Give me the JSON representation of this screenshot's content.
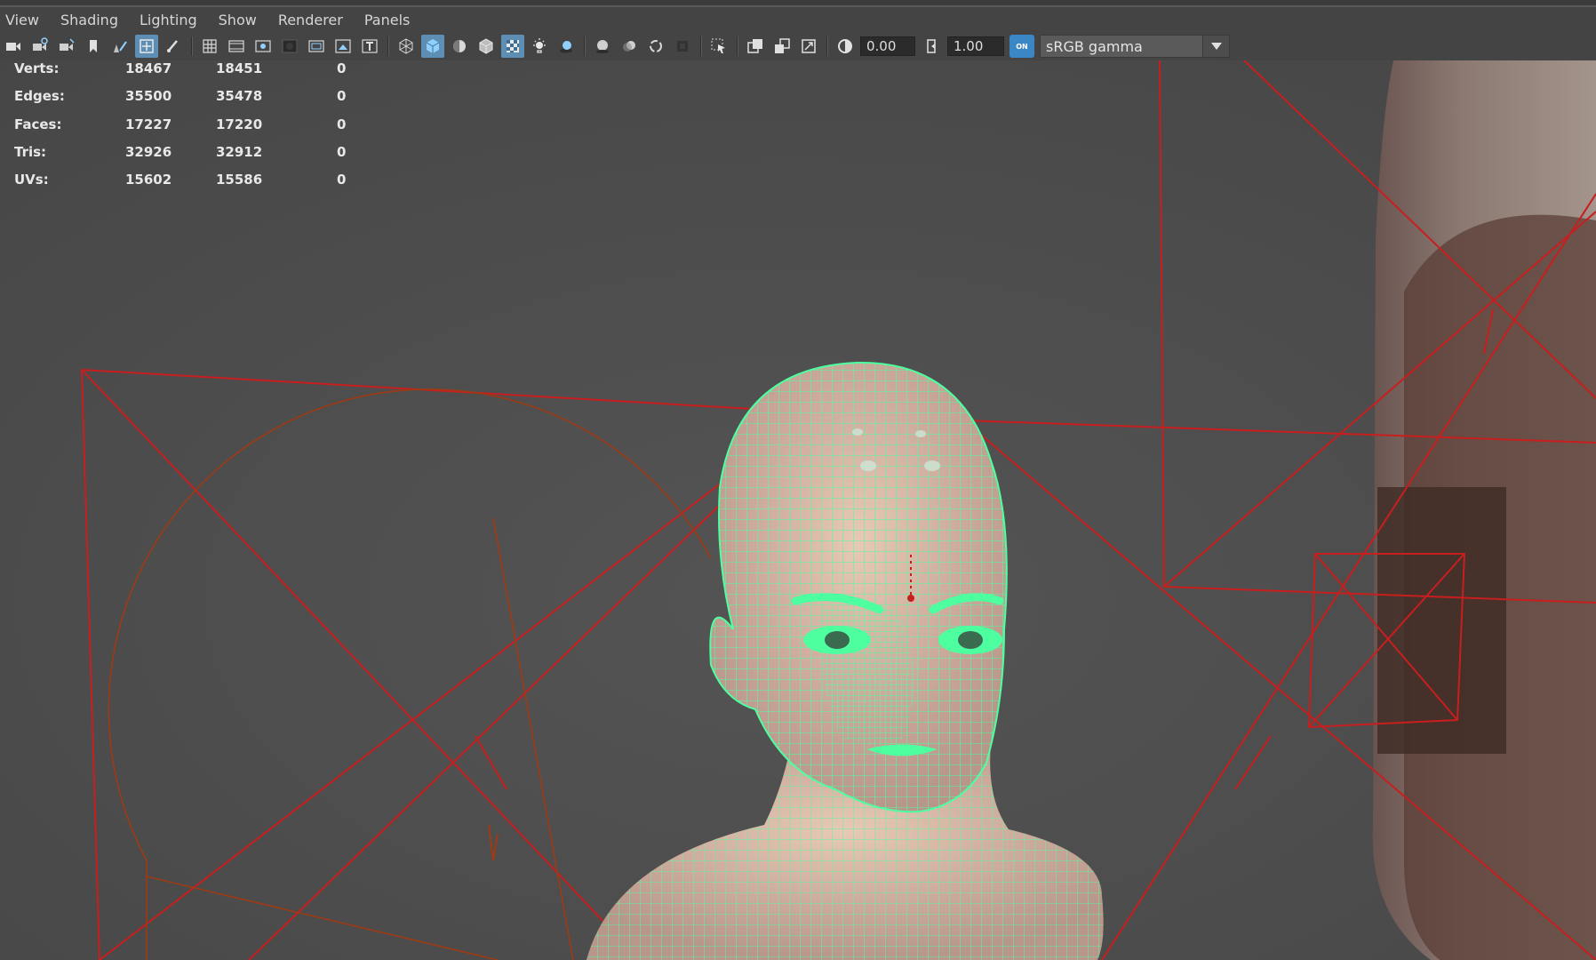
{
  "menu": [
    {
      "label": "View"
    },
    {
      "label": "Shading"
    },
    {
      "label": "Lighting"
    },
    {
      "label": "Show"
    },
    {
      "label": "Renderer"
    },
    {
      "label": "Panels"
    }
  ],
  "toolbar": {
    "icons_group1": [
      "select-camera-icon",
      "camera-attributes-icon",
      "bookmark-camera-icon",
      "image-plane-icon",
      "2d-pan-zoom-icon",
      "grease-pencil-icon"
    ],
    "icons_group2": [
      "grid-icon",
      "film-gate-icon",
      "resolution-gate-icon",
      "gate-mask-icon",
      "field-chart-icon",
      "safe-action-icon",
      "safe-title-icon"
    ],
    "icons_group3": [
      "wireframe-icon",
      "smooth-shade-icon",
      "default-material-icon",
      "wireframe-on-shaded-icon",
      "textured-icon",
      "use-all-lights-icon",
      "shadows-icon"
    ],
    "icons_group4": [
      "screen-space-ao-icon",
      "motion-blur-icon",
      "multisample-aa-icon",
      "depth-of-field-icon"
    ],
    "icons_group5": [
      "isolate-select-icon"
    ],
    "icons_group6": [
      "xray-icon",
      "xray-active-components-icon",
      "xray-joints-icon"
    ],
    "exposure_value": "0.00",
    "gamma_value": "1.00",
    "color_management_toggle": "ON",
    "view_transform": "sRGB gamma",
    "active_icons": [
      "2d-pan-zoom-icon",
      "smooth-shade-icon",
      "textured-icon"
    ],
    "accent_color": "#5d8fb5"
  },
  "hud": {
    "rows": [
      {
        "label": "Verts:",
        "v1": "18467",
        "v2": "18451",
        "v3": "0"
      },
      {
        "label": "Edges:",
        "v1": "35500",
        "v2": "35478",
        "v3": "0"
      },
      {
        "label": "Faces:",
        "v1": "17227",
        "v2": "17220",
        "v3": "0"
      },
      {
        "label": "Tris:",
        "v1": "32926",
        "v2": "32912",
        "v3": "0"
      },
      {
        "label": "UVs:",
        "v1": "15602",
        "v2": "15586",
        "v3": "0"
      }
    ]
  },
  "scene": {
    "viewport_bg": "#4a4a4a",
    "wireframe_color": "#4dff9f",
    "light_gizmo_color": "#c81e1e",
    "skin_color": "#d9b7a3"
  }
}
